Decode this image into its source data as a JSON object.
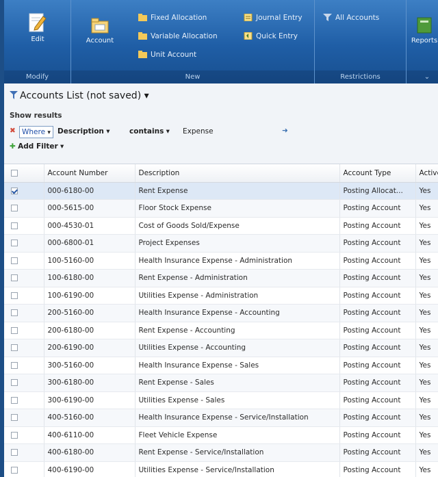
{
  "ribbon": {
    "modify": {
      "group_label": "Modify",
      "edit_label": "Edit"
    },
    "new": {
      "group_label": "New",
      "account_label": "Account",
      "fixed_allocation": "Fixed Allocation",
      "variable_allocation": "Variable Allocation",
      "unit_account": "Unit Account",
      "journal_entry": "Journal Entry",
      "quick_entry": "Quick Entry"
    },
    "restrictions": {
      "group_label": "Restrictions",
      "all_accounts": "All Accounts"
    },
    "reports": {
      "label": "Reports"
    }
  },
  "list": {
    "title": "Accounts List (not saved)",
    "show_results": "Show results",
    "filter": {
      "where": "Where",
      "field": "Description",
      "operator": "contains",
      "value": "Expense"
    },
    "add_filter": "Add Filter"
  },
  "table": {
    "columns": [
      "Account Number",
      "Description",
      "Account Type",
      "Active"
    ],
    "rows": [
      [
        "000-6180-00",
        "Rent Expense",
        "Posting Allocat...",
        "Yes"
      ],
      [
        "000-5615-00",
        "Floor Stock Expense",
        "Posting Account",
        "Yes"
      ],
      [
        "000-4530-01",
        "Cost of Goods Sold/Expense",
        "Posting Account",
        "Yes"
      ],
      [
        "000-6800-01",
        "Project Expenses",
        "Posting Account",
        "Yes"
      ],
      [
        "100-5160-00",
        "Health Insurance Expense - Administration",
        "Posting Account",
        "Yes"
      ],
      [
        "100-6180-00",
        "Rent Expense - Administration",
        "Posting Account",
        "Yes"
      ],
      [
        "100-6190-00",
        "Utilities Expense - Administration",
        "Posting Account",
        "Yes"
      ],
      [
        "200-5160-00",
        "Health Insurance Expense - Accounting",
        "Posting Account",
        "Yes"
      ],
      [
        "200-6180-00",
        "Rent Expense - Accounting",
        "Posting Account",
        "Yes"
      ],
      [
        "200-6190-00",
        "Utilities Expense - Accounting",
        "Posting Account",
        "Yes"
      ],
      [
        "300-5160-00",
        "Health Insurance Expense - Sales",
        "Posting Account",
        "Yes"
      ],
      [
        "300-6180-00",
        "Rent Expense - Sales",
        "Posting Account",
        "Yes"
      ],
      [
        "300-6190-00",
        "Utilities Expense - Sales",
        "Posting Account",
        "Yes"
      ],
      [
        "400-5160-00",
        "Health Insurance Expense - Service/Installation",
        "Posting Account",
        "Yes"
      ],
      [
        "400-6110-00",
        "Fleet Vehicle Expense",
        "Posting Account",
        "Yes"
      ],
      [
        "400-6180-00",
        "Rent Expense - Service/Installation",
        "Posting Account",
        "Yes"
      ],
      [
        "400-6190-00",
        "Utilities Expense - Service/Installation",
        "Posting Account",
        "Yes"
      ]
    ],
    "selected_row": 0
  }
}
